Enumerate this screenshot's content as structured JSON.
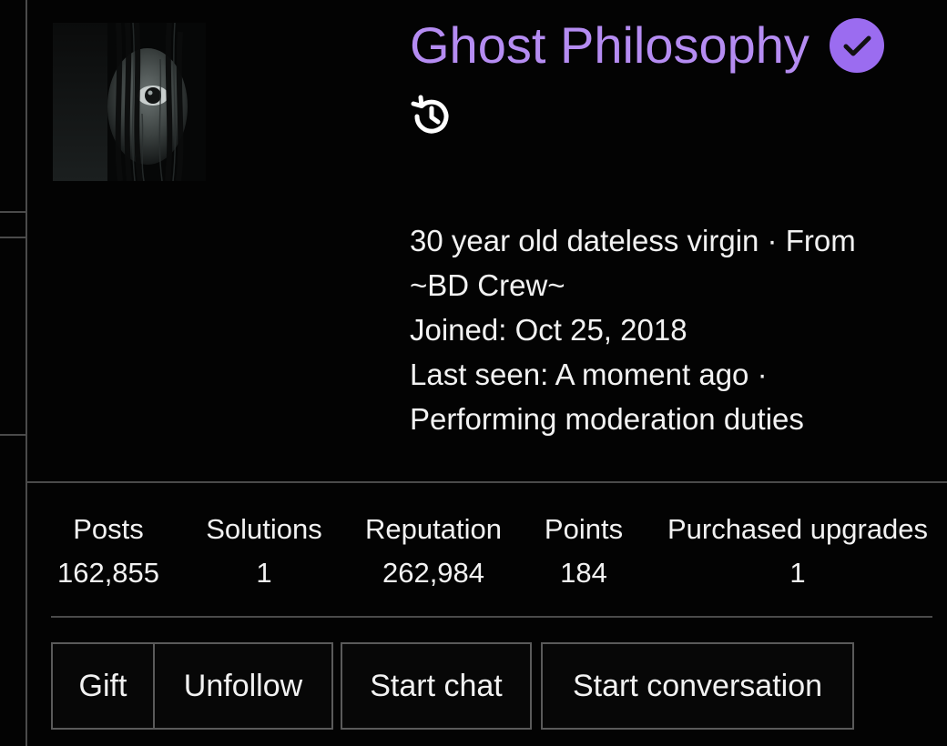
{
  "profile": {
    "name": "Ghost Philosophy",
    "verified_icon": "verified-check-icon",
    "history_icon": "history-icon",
    "tagline_line1": "30 year old dateless virgin · From",
    "tagline_line2": "~BD Crew~",
    "joined": "Joined: Oct 25, 2018",
    "last_seen_line1": "Last seen: A moment ago ·",
    "last_seen_line2": "Performing moderation duties"
  },
  "stats": [
    {
      "label": "Posts",
      "value": "162,855"
    },
    {
      "label": "Solutions",
      "value": "1"
    },
    {
      "label": "Reputation",
      "value": "262,984"
    },
    {
      "label": "Points",
      "value": "184"
    },
    {
      "label": "Purchased upgrades",
      "value": "1"
    }
  ],
  "actions": {
    "gift": "Gift",
    "unfollow": "Unfollow",
    "start_chat": "Start chat",
    "start_conversation": "Start conversation"
  },
  "colors": {
    "background": "#030303",
    "name": "#b58cf2",
    "verified_badge": "#9b6cf0",
    "border": "#5a5a5a",
    "text": "#f2f2f2"
  }
}
